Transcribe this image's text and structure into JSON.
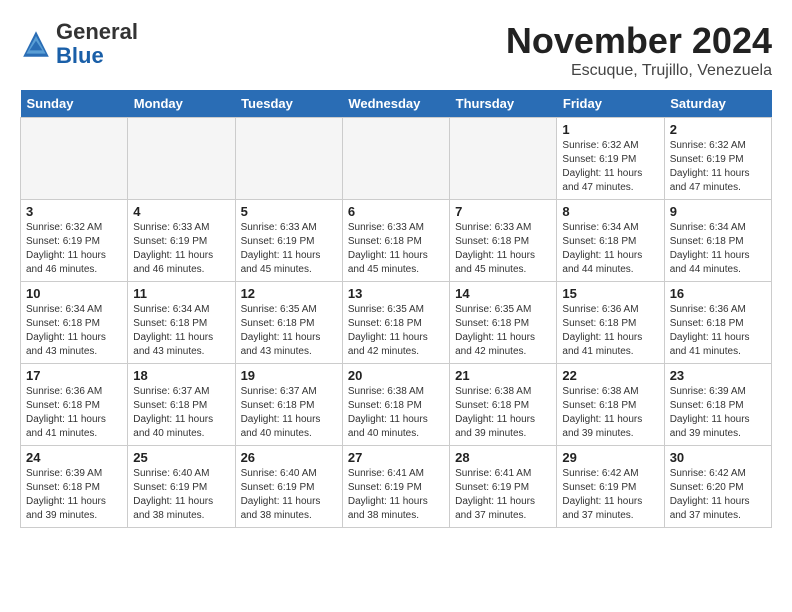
{
  "header": {
    "logo_general": "General",
    "logo_blue": "Blue",
    "month_title": "November 2024",
    "subtitle": "Escuque, Trujillo, Venezuela"
  },
  "days_of_week": [
    "Sunday",
    "Monday",
    "Tuesday",
    "Wednesday",
    "Thursday",
    "Friday",
    "Saturday"
  ],
  "weeks": [
    [
      {
        "day": "",
        "info": ""
      },
      {
        "day": "",
        "info": ""
      },
      {
        "day": "",
        "info": ""
      },
      {
        "day": "",
        "info": ""
      },
      {
        "day": "",
        "info": ""
      },
      {
        "day": "1",
        "info": "Sunrise: 6:32 AM\nSunset: 6:19 PM\nDaylight: 11 hours and 47 minutes."
      },
      {
        "day": "2",
        "info": "Sunrise: 6:32 AM\nSunset: 6:19 PM\nDaylight: 11 hours and 47 minutes."
      }
    ],
    [
      {
        "day": "3",
        "info": "Sunrise: 6:32 AM\nSunset: 6:19 PM\nDaylight: 11 hours and 46 minutes."
      },
      {
        "day": "4",
        "info": "Sunrise: 6:33 AM\nSunset: 6:19 PM\nDaylight: 11 hours and 46 minutes."
      },
      {
        "day": "5",
        "info": "Sunrise: 6:33 AM\nSunset: 6:19 PM\nDaylight: 11 hours and 45 minutes."
      },
      {
        "day": "6",
        "info": "Sunrise: 6:33 AM\nSunset: 6:18 PM\nDaylight: 11 hours and 45 minutes."
      },
      {
        "day": "7",
        "info": "Sunrise: 6:33 AM\nSunset: 6:18 PM\nDaylight: 11 hours and 45 minutes."
      },
      {
        "day": "8",
        "info": "Sunrise: 6:34 AM\nSunset: 6:18 PM\nDaylight: 11 hours and 44 minutes."
      },
      {
        "day": "9",
        "info": "Sunrise: 6:34 AM\nSunset: 6:18 PM\nDaylight: 11 hours and 44 minutes."
      }
    ],
    [
      {
        "day": "10",
        "info": "Sunrise: 6:34 AM\nSunset: 6:18 PM\nDaylight: 11 hours and 43 minutes."
      },
      {
        "day": "11",
        "info": "Sunrise: 6:34 AM\nSunset: 6:18 PM\nDaylight: 11 hours and 43 minutes."
      },
      {
        "day": "12",
        "info": "Sunrise: 6:35 AM\nSunset: 6:18 PM\nDaylight: 11 hours and 43 minutes."
      },
      {
        "day": "13",
        "info": "Sunrise: 6:35 AM\nSunset: 6:18 PM\nDaylight: 11 hours and 42 minutes."
      },
      {
        "day": "14",
        "info": "Sunrise: 6:35 AM\nSunset: 6:18 PM\nDaylight: 11 hours and 42 minutes."
      },
      {
        "day": "15",
        "info": "Sunrise: 6:36 AM\nSunset: 6:18 PM\nDaylight: 11 hours and 41 minutes."
      },
      {
        "day": "16",
        "info": "Sunrise: 6:36 AM\nSunset: 6:18 PM\nDaylight: 11 hours and 41 minutes."
      }
    ],
    [
      {
        "day": "17",
        "info": "Sunrise: 6:36 AM\nSunset: 6:18 PM\nDaylight: 11 hours and 41 minutes."
      },
      {
        "day": "18",
        "info": "Sunrise: 6:37 AM\nSunset: 6:18 PM\nDaylight: 11 hours and 40 minutes."
      },
      {
        "day": "19",
        "info": "Sunrise: 6:37 AM\nSunset: 6:18 PM\nDaylight: 11 hours and 40 minutes."
      },
      {
        "day": "20",
        "info": "Sunrise: 6:38 AM\nSunset: 6:18 PM\nDaylight: 11 hours and 40 minutes."
      },
      {
        "day": "21",
        "info": "Sunrise: 6:38 AM\nSunset: 6:18 PM\nDaylight: 11 hours and 39 minutes."
      },
      {
        "day": "22",
        "info": "Sunrise: 6:38 AM\nSunset: 6:18 PM\nDaylight: 11 hours and 39 minutes."
      },
      {
        "day": "23",
        "info": "Sunrise: 6:39 AM\nSunset: 6:18 PM\nDaylight: 11 hours and 39 minutes."
      }
    ],
    [
      {
        "day": "24",
        "info": "Sunrise: 6:39 AM\nSunset: 6:18 PM\nDaylight: 11 hours and 39 minutes."
      },
      {
        "day": "25",
        "info": "Sunrise: 6:40 AM\nSunset: 6:19 PM\nDaylight: 11 hours and 38 minutes."
      },
      {
        "day": "26",
        "info": "Sunrise: 6:40 AM\nSunset: 6:19 PM\nDaylight: 11 hours and 38 minutes."
      },
      {
        "day": "27",
        "info": "Sunrise: 6:41 AM\nSunset: 6:19 PM\nDaylight: 11 hours and 38 minutes."
      },
      {
        "day": "28",
        "info": "Sunrise: 6:41 AM\nSunset: 6:19 PM\nDaylight: 11 hours and 37 minutes."
      },
      {
        "day": "29",
        "info": "Sunrise: 6:42 AM\nSunset: 6:19 PM\nDaylight: 11 hours and 37 minutes."
      },
      {
        "day": "30",
        "info": "Sunrise: 6:42 AM\nSunset: 6:20 PM\nDaylight: 11 hours and 37 minutes."
      }
    ]
  ]
}
